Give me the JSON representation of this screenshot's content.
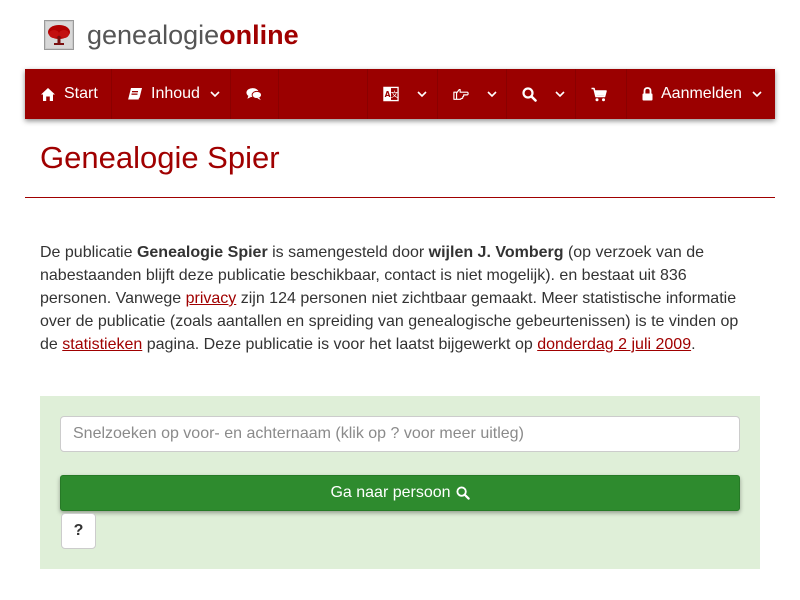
{
  "brand": {
    "name_prefix": "genealogie",
    "name_accent": "online"
  },
  "nav": {
    "start_label": "Start",
    "inhoud_label": "Inhoud",
    "aanmelden_label": "Aanmelden"
  },
  "icons": {
    "home": "home-icon",
    "book": "book-icon",
    "chat": "comments-icon",
    "language": "language-icon",
    "pointer": "hand-pointer-icon",
    "search": "search-icon",
    "cart": "shopping-cart-icon",
    "lock": "lock-icon",
    "chevron": "chevron-down-icon"
  },
  "page": {
    "title": "Genealogie Spier"
  },
  "intro": {
    "t1": "De publicatie ",
    "pub_name": "Genealogie Spier",
    "t2": " is samengesteld door ",
    "author": "wijlen J. Vomberg",
    "t3": " (op verzoek van de nabestaanden blijft deze publicatie beschikbaar, contact is niet mogelijk). en bestaat uit 836 personen. Vanwege ",
    "privacy_link": "privacy",
    "t4": " zijn 124 personen niet zichtbaar gemaakt. Meer statistische informatie over de publicatie (zoals aantallen en spreiding van genealogische gebeurtenissen) is te vinden op de ",
    "stats_link": "statistieken",
    "t5": " pagina. Deze publicatie is voor het laatst bijgewerkt op ",
    "date_link": "donderdag 2 juli 2009",
    "t6": "."
  },
  "search": {
    "placeholder": "Snelzoeken op voor- en achternaam (klik op ? voor meer uitleg)",
    "value": "",
    "go_label": "Ga naar persoon",
    "help_label": "?"
  },
  "colors": {
    "brand_red": "#9b0000",
    "title_red": "#a00000",
    "panel_green": "#dfefd8",
    "button_green": "#2e8b2e"
  }
}
